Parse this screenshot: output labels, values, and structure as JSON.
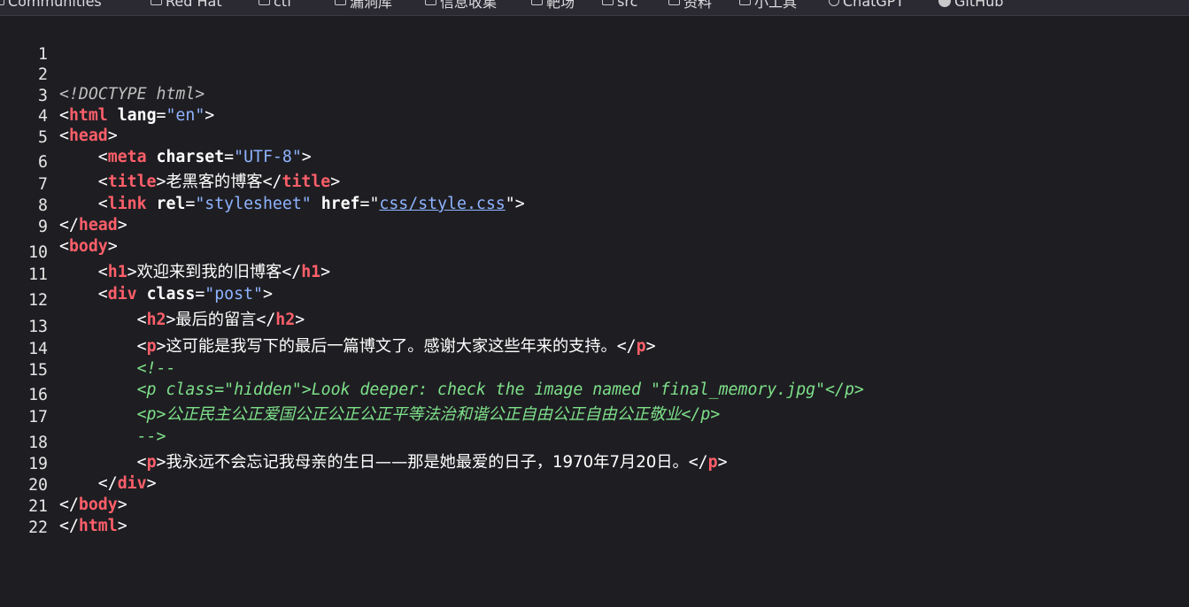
{
  "bookmarks": [
    {
      "icon": "folder-icon",
      "label": "Communities"
    },
    {
      "icon": "folder-icon",
      "label": "Red Hat"
    },
    {
      "icon": "folder-icon",
      "label": "ctf"
    },
    {
      "icon": "folder-icon",
      "label": "漏洞库"
    },
    {
      "icon": "folder-icon",
      "label": "信息收集"
    },
    {
      "icon": "folder-icon",
      "label": "靶场"
    },
    {
      "icon": "folder-icon",
      "label": "src"
    },
    {
      "icon": "folder-icon",
      "label": "资料"
    },
    {
      "icon": "folder-icon",
      "label": "小工具"
    },
    {
      "icon": "ai-icon",
      "label": "ChatGPT"
    },
    {
      "icon": "github-icon",
      "label": "GitHub"
    }
  ],
  "code": {
    "line_numbers": [
      "1",
      "2",
      "3",
      "4",
      "5",
      "6",
      "7",
      "8",
      "9",
      "10",
      "11",
      "12",
      "13",
      "14",
      "15",
      "16",
      "17",
      "18",
      "19",
      "20",
      "21",
      "22"
    ],
    "doctype": "<!DOCTYPE html>",
    "lang_value": "\"en\"",
    "charset_value": "\"UTF-8\"",
    "title_text": "老黑客的博客",
    "rel_value": "\"stylesheet\"",
    "href_value": "css/style.css",
    "h1_text": "欢迎来到我的旧博客",
    "class_value": "\"post\"",
    "h2_text": "最后的留言",
    "p1_text": "这可能是我写下的最后一篇博文了。感谢大家这些年来的支持。",
    "comment_open": "<!--",
    "comment_line1": "<p class=\"hidden\">Look deeper: check the image named \"final_memory.jpg\"</p>",
    "comment_line2_open": "<p>",
    "comment_line2_text": "公正民主公正爱国公正公正公正平等法治和谐公正自由公正自由公正敬业",
    "comment_line2_close": "</p>",
    "comment_close": "-->",
    "p2_text": "我永远不会忘记我母亲的生日——那是她最爱的日子，1970年7月20日。"
  }
}
